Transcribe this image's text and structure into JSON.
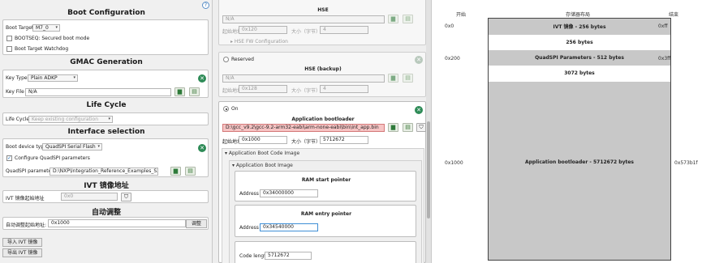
{
  "left": {
    "help": "?",
    "boot": {
      "title": "Boot Configuration",
      "target_label": "Boot Target",
      "target_value": "M7_0",
      "secured_label": "BOOTSEQ: Secured boot mode",
      "watchdog_label": "Boot Target Watchdog"
    },
    "gmac": {
      "title": "GMAC Generation",
      "keytype_label": "Key Type",
      "keytype_value": "Plain ADKP",
      "keyfile_label": "Key File",
      "keyfile_value": "N/A"
    },
    "lifecycle": {
      "title": "Life Cycle",
      "label": "Life Cycle",
      "value": "Keep existing configuration"
    },
    "iface": {
      "title": "Interface selection",
      "device_label": "Boot device type",
      "device_value": "QuadSPI Serial Flash",
      "config_label": "Configure QuadSPI parameters",
      "params_label": "QuadSPI parameters",
      "params_value": "D:\\NXP\\Integration_Reference_Examples_S32G2_2"
    },
    "ivt": {
      "title": "IVT 镜像地址",
      "label": "IVT 镜像起始地址",
      "value": "0x0"
    },
    "auto": {
      "title": "自动调整",
      "label": "自动调整起始地址:",
      "value": "0x1000",
      "button": "调整"
    },
    "import_btn": "导入 IVT 镜像",
    "export_btn": "导出 IVT 镜像"
  },
  "mid": {
    "hse": {
      "title": "HSE",
      "value": "N/A",
      "start_label": "起始地址",
      "start_value": "0x120",
      "size_label": "大小（字节）",
      "size_value": "4",
      "fw_label": "HSE FW Configuration"
    },
    "hse_backup": {
      "radio_label": "Reserved",
      "title": "HSE (backup)",
      "value": "N/A",
      "start_label": "起始地址",
      "start_value": "0x128",
      "size_label": "大小（字节）",
      "size_value": "4"
    },
    "app": {
      "radio_label": "On",
      "title": "Application bootloader",
      "path": "D:\\gcc_v9.2\\gcc-9.2-arm32-eabi\\arm-none-eabi\\bin\\int_app.bin",
      "start_label": "起始地址",
      "start_value": "0x1000",
      "size_label": "大小（字节）",
      "size_value": "5712672",
      "code_image": "Application Boot Code Image",
      "boot_image": "Application Boot Image"
    },
    "ram_start": {
      "title": "RAM start pointer",
      "addr_label": "Address",
      "addr_value": "0x34000000"
    },
    "ram_entry": {
      "title": "RAM entry pointer",
      "addr_label": "Address",
      "addr_value": "0x34540000"
    },
    "code_len": {
      "label": "Code length",
      "value": "5712672"
    }
  },
  "right": {
    "h_start": "开始",
    "h_layout": "存储器布局",
    "h_end": "结束",
    "blocks": [
      {
        "label": "IVT 镜像 - 256 bytes",
        "start": "0x0",
        "end": "0xff"
      },
      {
        "label": "256 bytes",
        "start": "",
        "end": ""
      },
      {
        "label": "QuadSPI Parameters - 512 bytes",
        "start": "0x200",
        "end": "0x3ff"
      },
      {
        "label": "3072 bytes",
        "start": "",
        "end": ""
      },
      {
        "label": "Application bootloader - 5712672 bytes",
        "start": "0x1000",
        "end": "0x573b1f"
      }
    ]
  },
  "colors": {
    "accent": "#2e8b57",
    "error_bg": "#f6c4c4",
    "block_gray": "#c8c8c8"
  }
}
